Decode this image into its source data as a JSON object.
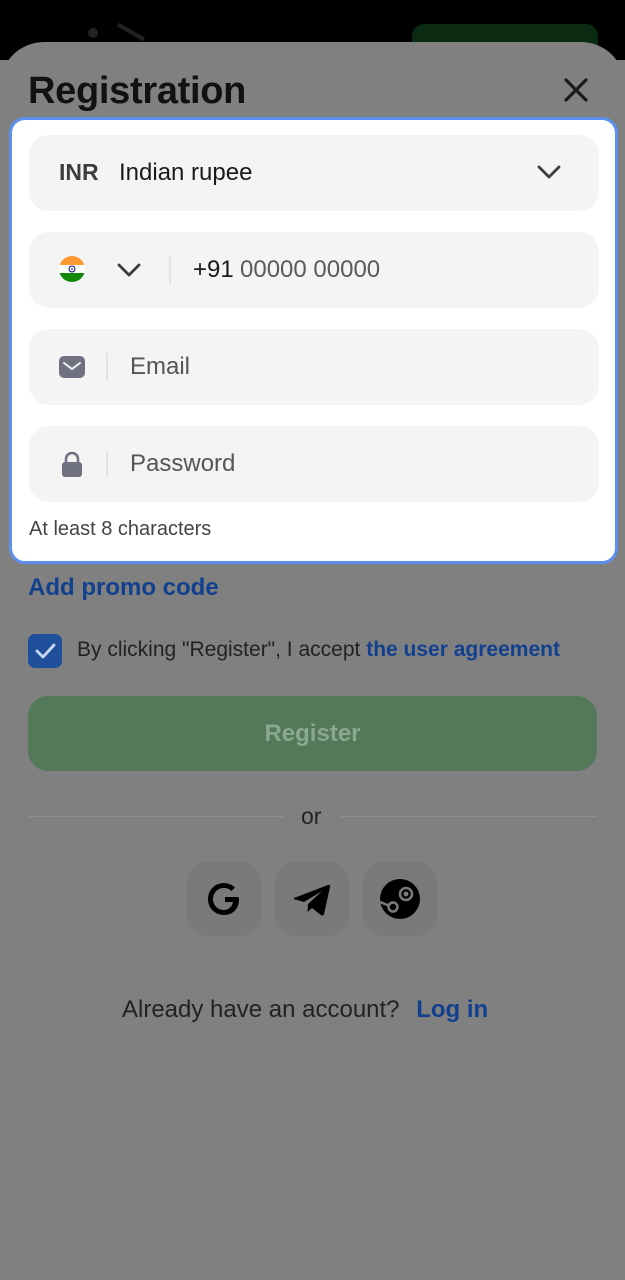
{
  "header": {
    "title": "Registration"
  },
  "currency": {
    "code": "INR",
    "name": "Indian rupee"
  },
  "phone": {
    "country": "India",
    "prefix": "+91",
    "mask": "00000 00000"
  },
  "email": {
    "placeholder": "Email"
  },
  "password": {
    "placeholder": "Password",
    "hint": "At least 8 characters"
  },
  "promo": {
    "label": "Add promo code"
  },
  "agreement": {
    "checked": true,
    "text": "By clicking \"Register\", I accept",
    "link": "the user agreement"
  },
  "actions": {
    "register_label": "Register",
    "or_label": "or"
  },
  "social": [
    {
      "name": "google-icon"
    },
    {
      "name": "telegram-icon"
    },
    {
      "name": "steam-icon"
    }
  ],
  "footer": {
    "text": "Already have an account?",
    "login_label": "Log in"
  },
  "colors": {
    "accent": "#11408f",
    "focus_border": "#5d8ff1",
    "register_bg": "#537959",
    "overlay": "#808080"
  }
}
